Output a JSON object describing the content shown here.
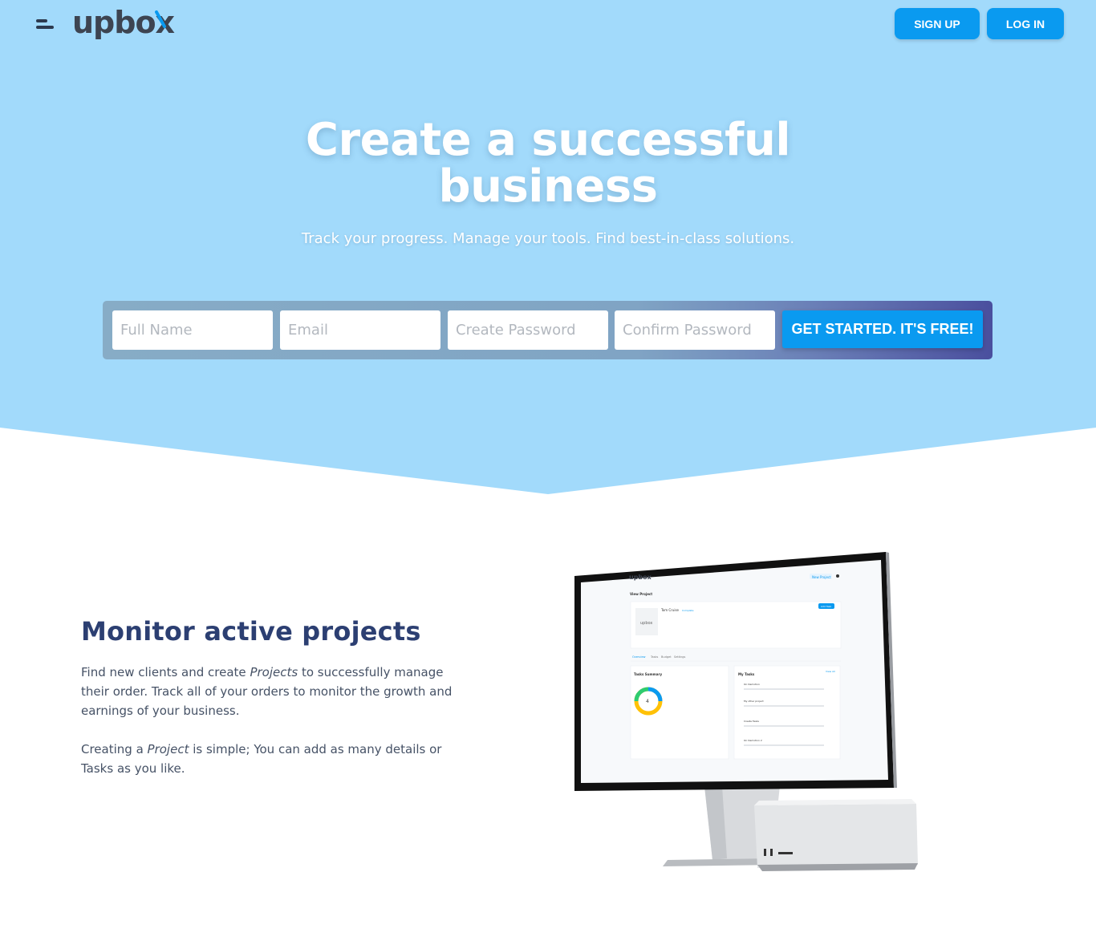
{
  "header": {
    "logo_text": "upbox",
    "signup_label": "SIGN UP",
    "login_label": "LOG IN"
  },
  "hero": {
    "title_line1": "Create a successful",
    "title_line2": "business",
    "subtitle": "Track your progress. Manage your tools. Find best-in-class solutions."
  },
  "form": {
    "full_name_placeholder": "Full Name",
    "email_placeholder": "Email",
    "create_password_placeholder": "Create Password",
    "confirm_password_placeholder": "Confirm Password",
    "cta_label": "GET STARTED. IT'S FREE!"
  },
  "feature": {
    "title": "Monitor active projects",
    "p1_before": "Find new clients and create ",
    "p1_em": "Projects",
    "p1_after": " to successfully manage their order. Track all of your orders to monitor the growth and earnings of your business.",
    "p2_before": "Creating a ",
    "p2_em": "Project",
    "p2_after": " is simple; You can add as many details or Tasks as you like."
  },
  "device_screen": {
    "logo": "upbox",
    "new_project": "New Project",
    "page_title": "View Project",
    "project_name": "Tom Cruise",
    "status": "Complete",
    "add_task": "Add Task",
    "tabs": [
      "Overview",
      "Tasks",
      "Budget",
      "Settings"
    ],
    "tasks_summary": "Tasks Summary",
    "donut_value": "4",
    "my_tasks": "My Tasks",
    "view_all": "View All",
    "task_items": [
      "On Demotion",
      "My other project",
      "Create Tasks",
      "On Demotion 2"
    ]
  },
  "colors": {
    "hero_bg": "#a2dafb",
    "primary": "#0a9af0",
    "heading_blue": "#2c3f72"
  }
}
